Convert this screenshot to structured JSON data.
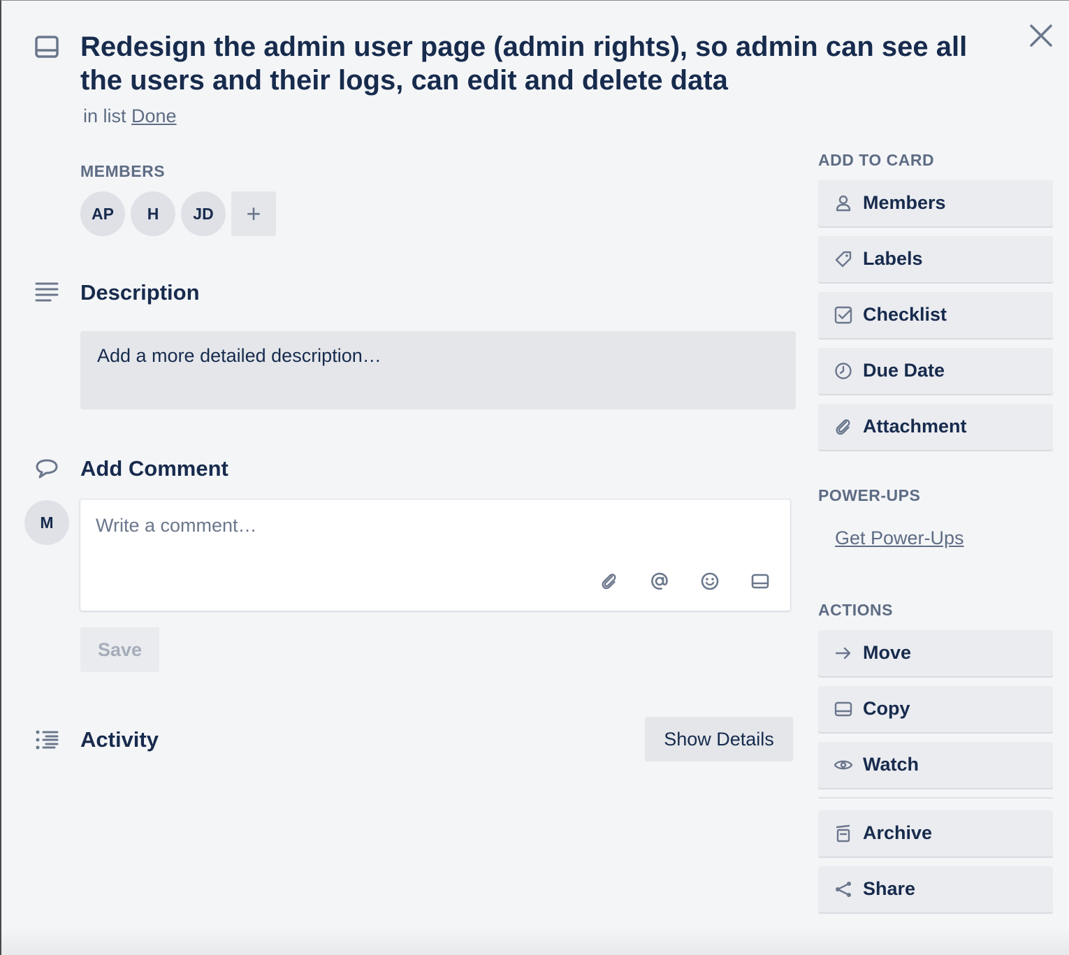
{
  "card": {
    "title": "Redesign the admin user page (admin rights), so admin can see all the users and their logs, can edit and delete data",
    "in_list_prefix": "in list",
    "list_name": "Done"
  },
  "members": {
    "heading": "MEMBERS",
    "items": [
      "AP",
      "H",
      "JD"
    ],
    "add_label": "+"
  },
  "description": {
    "title": "Description",
    "placeholder": "Add a more detailed description…"
  },
  "comment": {
    "title": "Add Comment",
    "avatar": "M",
    "placeholder": "Write a comment…",
    "save_label": "Save"
  },
  "activity": {
    "title": "Activity",
    "show_details_label": "Show Details"
  },
  "sidebar": {
    "add_to_card_heading": "ADD TO CARD",
    "add_to_card": [
      {
        "label": "Members",
        "icon": "person-icon"
      },
      {
        "label": "Labels",
        "icon": "tag-icon"
      },
      {
        "label": "Checklist",
        "icon": "checkbox-icon"
      },
      {
        "label": "Due Date",
        "icon": "clock-icon"
      },
      {
        "label": "Attachment",
        "icon": "paperclip-icon"
      }
    ],
    "powerups_heading": "POWER-UPS",
    "powerups_link": "Get Power-Ups",
    "actions_heading": "ACTIONS",
    "actions": [
      {
        "label": "Move",
        "icon": "arrow-right-icon"
      },
      {
        "label": "Copy",
        "icon": "card-icon"
      },
      {
        "label": "Watch",
        "icon": "eye-icon"
      },
      {
        "label": "Archive",
        "icon": "archive-icon"
      },
      {
        "label": "Share",
        "icon": "share-icon"
      }
    ]
  },
  "colors": {
    "background": "#f4f5f7",
    "text": "#172b4d",
    "muted": "#5e6c84",
    "button": "#ebecf0"
  }
}
